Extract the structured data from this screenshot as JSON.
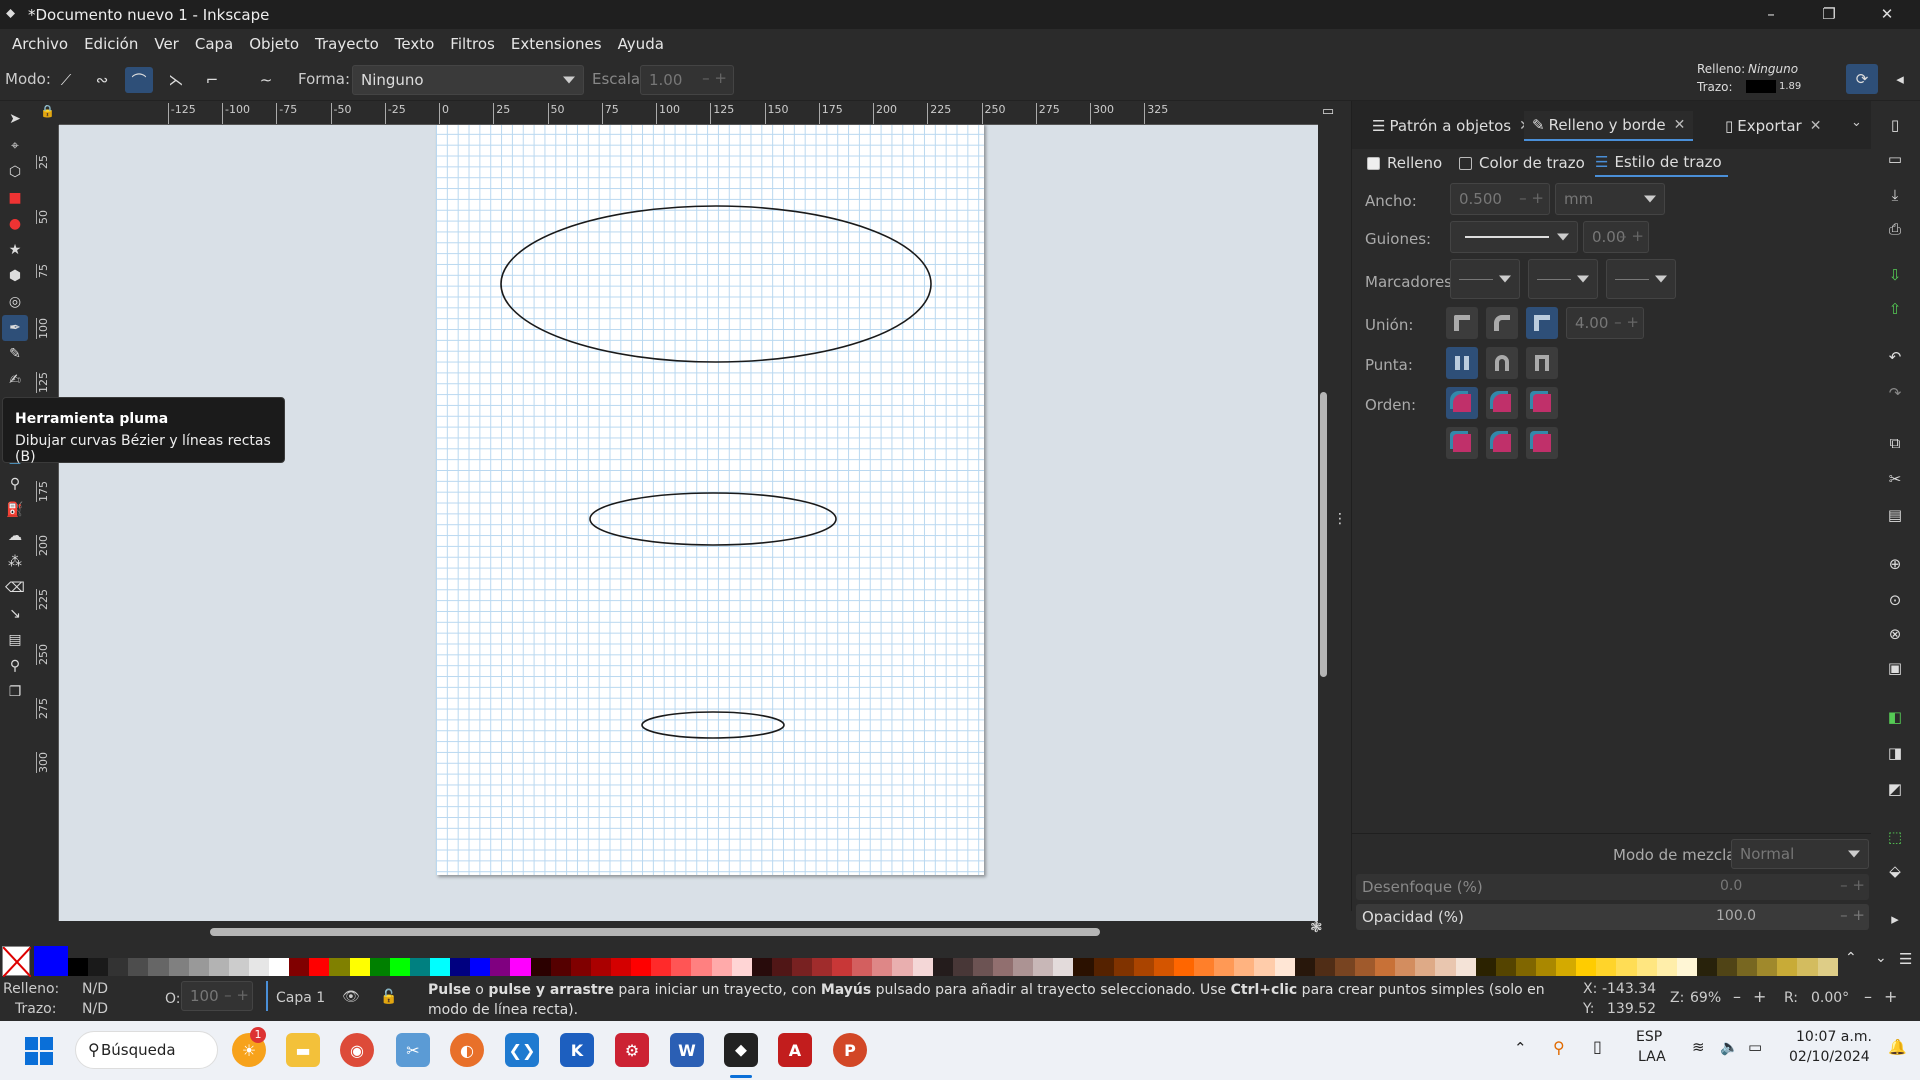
{
  "window": {
    "title": "*Documento nuevo 1 - Inkscape",
    "minimize": "–",
    "maximize": "❐",
    "close": "✕"
  },
  "menu": [
    "Archivo",
    "Edición",
    "Ver",
    "Capa",
    "Objeto",
    "Trayecto",
    "Texto",
    "Filtros",
    "Extensiones",
    "Ayuda"
  ],
  "toolcontrols": {
    "mode_label": "Modo:",
    "shape_label": "Forma:",
    "shape_value": "Ninguno",
    "scale_label": "Escala:",
    "scale_value": "1.00",
    "fill_label": "Relleno:",
    "fill_value": "Ninguno",
    "stroke_label": "Trazo:",
    "stroke_width": "1.89"
  },
  "ruler_h": [
    "-125",
    "-100",
    "-75",
    "-50",
    "-25",
    "0",
    "25",
    "50",
    "75",
    "100",
    "125",
    "150",
    "175",
    "200",
    "225",
    "250",
    "275",
    "300",
    "325"
  ],
  "ruler_v": [
    "25",
    "50",
    "75",
    "100",
    "125",
    "150",
    "175",
    "200",
    "225",
    "250",
    "275",
    "300"
  ],
  "tooltip": {
    "title": "Herramienta pluma",
    "desc": "Dibujar curvas Bézier y líneas rectas (B)"
  },
  "dock": {
    "tabs": [
      {
        "label": "Patrón a objetos",
        "close": "✕"
      },
      {
        "label": "Relleno y borde",
        "close": "✕"
      },
      {
        "label": "Exportar",
        "close": "✕"
      }
    ],
    "subtabs": [
      "Relleno",
      "Color de trazo",
      "Estilo de trazo"
    ],
    "width_label": "Ancho:",
    "width_value": "0.500",
    "width_unit": "mm",
    "dashes_label": "Guiones:",
    "dashes_offset": "0.00",
    "markers_label": "Marcadores:",
    "join_label": "Unión:",
    "miter_value": "4.00",
    "cap_label": "Punta:",
    "order_label": "Orden:",
    "blend_label": "Modo de mezcla:",
    "blend_value": "Normal",
    "blur_label": "Desenfoque (%)",
    "blur_value": "0.0",
    "opacity_label": "Opacidad (%)",
    "opacity_value": "100.0"
  },
  "palette": [
    "#000000",
    "#1a1a1a",
    "#333333",
    "#4d4d4d",
    "#666666",
    "#808080",
    "#999999",
    "#b3b3b3",
    "#cccccc",
    "#e6e6e6",
    "#ffffff",
    "#800000",
    "#ff0000",
    "#808000",
    "#ffff00",
    "#008000",
    "#00ff00",
    "#008080",
    "#00ffff",
    "#000080",
    "#0000ff",
    "#800080",
    "#ff00ff",
    "#2b0000",
    "#550000",
    "#800000",
    "#aa0000",
    "#d40000",
    "#ff0000",
    "#ff2a2a",
    "#ff5555",
    "#ff8080",
    "#ffaaaa",
    "#ffd5d5",
    "#280b0b",
    "#501616",
    "#782121",
    "#a02c2c",
    "#c83737",
    "#d35f5f",
    "#de8787",
    "#e9afaf",
    "#f4d7d7",
    "#241c1c",
    "#483737",
    "#6c5353",
    "#916f6f",
    "#ac9393",
    "#c8b7b7",
    "#e3dbdb",
    "#2b1100",
    "#552200",
    "#803300",
    "#aa4400",
    "#d45500",
    "#ff6600",
    "#ff7f2a",
    "#ff9955",
    "#ffb380",
    "#ffccaa",
    "#ffe6d5",
    "#28170b",
    "#502d16",
    "#784421",
    "#a05a2c",
    "#c87137",
    "#d38d5f",
    "#deaa87",
    "#e9c6af",
    "#f4e3d7",
    "#2b2200",
    "#554400",
    "#806600",
    "#aa8800",
    "#d4aa00",
    "#ffcc00",
    "#ffd42a",
    "#ffdd55",
    "#ffe680",
    "#ffeeaa",
    "#fff6d5",
    "#28220b",
    "#504416",
    "#786721",
    "#a0892c",
    "#c8ab37",
    "#d3bc5f",
    "#decd87"
  ],
  "status": {
    "fill_label": "Relleno:",
    "fill_value": "N/D",
    "stroke_label": "Trazo:",
    "stroke_value": "N/D",
    "opacity_label": "O:",
    "opacity_value": "100",
    "layer": "Capa 1",
    "msg_b1": "Pulse",
    "msg_t1": " o ",
    "msg_b2": "pulse y arrastre",
    "msg_t2": " para iniciar un trayecto, con ",
    "msg_b3": "Mayús",
    "msg_t3": " pulsado para añadir al trayecto seleccionado. Use ",
    "msg_b4": "Ctrl+clic",
    "msg_t4": " para crear puntos simples (solo en modo de línea recta).",
    "x_label": "X:",
    "x_value": "-143.34",
    "y_label": "Y:",
    "y_value": "139.52",
    "zoom_label": "Z:",
    "zoom_value": "69%",
    "rot_label": "R:",
    "rot_value": "0.00°"
  },
  "taskbar": {
    "search": "Búsqueda",
    "lang1": "ESP",
    "lang2": "LAA",
    "time": "10:07 a.m.",
    "date": "02/10/2024",
    "badge": "1"
  }
}
